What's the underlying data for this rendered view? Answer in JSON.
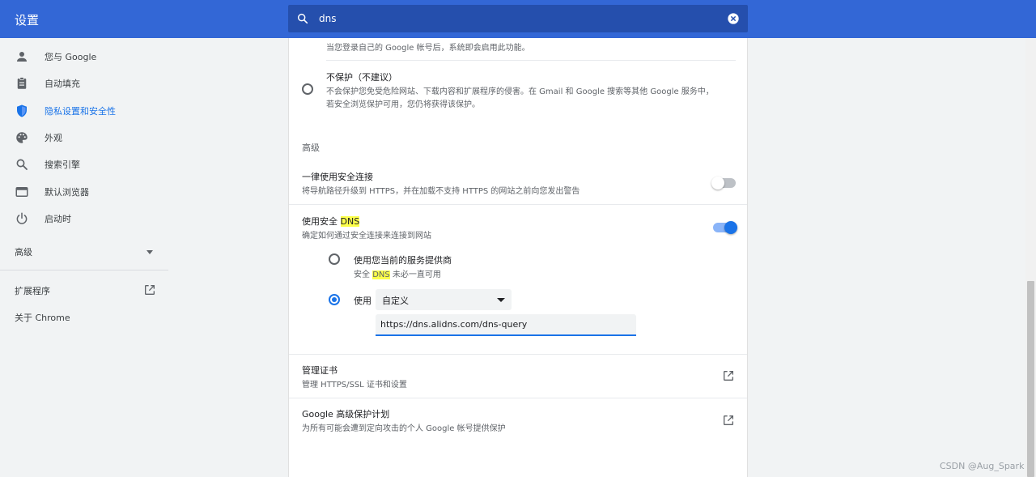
{
  "app": {
    "title": "设置"
  },
  "search": {
    "value": "dns"
  },
  "sidebar": {
    "items": [
      {
        "label": "您与 Google",
        "icon": "person-icon"
      },
      {
        "label": "自动填充",
        "icon": "clipboard-icon"
      },
      {
        "label": "隐私设置和安全性",
        "icon": "shield-icon",
        "active": true
      },
      {
        "label": "外观",
        "icon": "palette-icon"
      },
      {
        "label": "搜索引擎",
        "icon": "search-icon"
      },
      {
        "label": "默认浏览器",
        "icon": "browser-icon"
      },
      {
        "label": "启动时",
        "icon": "power-icon"
      }
    ],
    "advanced": "高级",
    "extensions": "扩展程序",
    "about": "关于 Chrome"
  },
  "main": {
    "top_note": "当您登录自己的 Google 帐号后，系统即会启用此功能。",
    "no_protection": {
      "title": "不保护（不建议）",
      "desc_line1": "不会保护您免受危险网站、下载内容和扩展程序的侵害。在 Gmail 和 Google 搜索等其他 Google 服务中，",
      "desc_line2": "若安全浏览保护可用，您仍将获得该保护。"
    },
    "advanced_heading": "高级",
    "https_always": {
      "title": "一律使用安全连接",
      "desc": "将导航路径升级到 HTTPS，并在加载不支持 HTTPS 的网站之前向您发出警告",
      "enabled": false
    },
    "secure_dns": {
      "title_prefix": "使用安全 ",
      "title_highlight": "DNS",
      "desc": "确定如何通过安全连接来连接到网站",
      "enabled": true,
      "option_current": {
        "title": "使用您当前的服务提供商",
        "desc_prefix": "安全 ",
        "desc_highlight": "DNS",
        "desc_suffix": " 未必一直可用"
      },
      "option_custom": {
        "label": "使用",
        "selected": "自定义",
        "url": "https://dns.alidns.com/dns-query"
      }
    },
    "manage_certs": {
      "title": "管理证书",
      "desc": "管理 HTTPS/SSL 证书和设置"
    },
    "advanced_protection": {
      "title": "Google 高级保护计划",
      "desc": "为所有可能会遭到定向攻击的个人 Google 帐号提供保护"
    }
  },
  "colors": {
    "header": "#3367d6",
    "accent": "#1a73e8",
    "highlight": "#fcff4a"
  },
  "watermark": "CSDN @Aug_Spark"
}
